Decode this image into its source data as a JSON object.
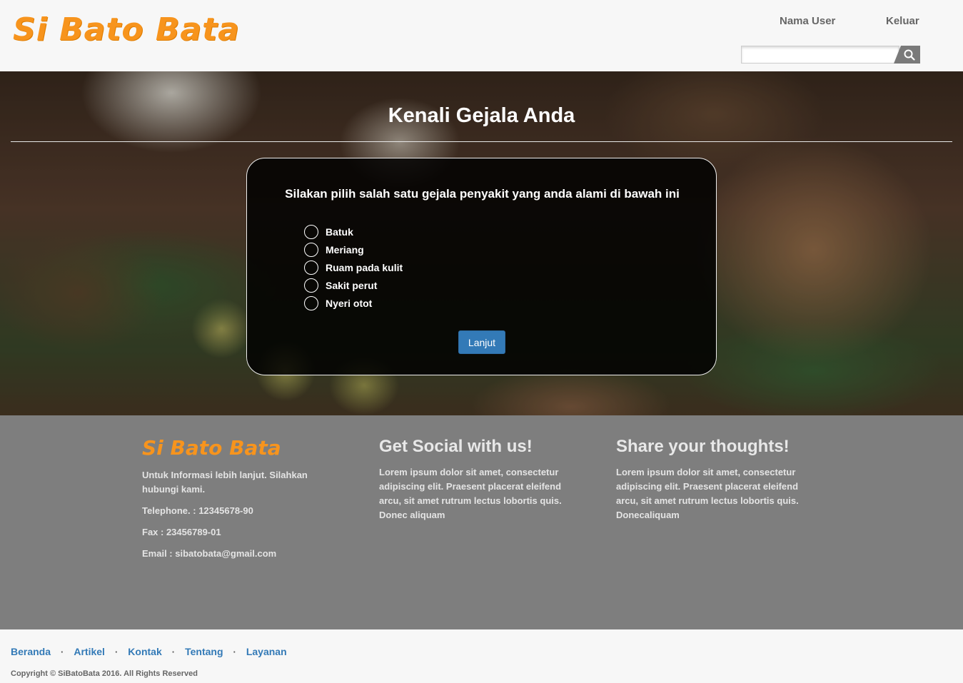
{
  "header": {
    "logo": "Si Bato Bata",
    "user_label": "Nama User",
    "logout_label": "Keluar",
    "search": {
      "value": "",
      "placeholder": "",
      "icon": "search-icon"
    }
  },
  "hero": {
    "title": "Kenali Gejala Anda",
    "question": "Silakan pilih salah satu gejala penyakit yang anda alami di bawah ini",
    "options": [
      {
        "label": "Batuk",
        "selected": false
      },
      {
        "label": "Meriang",
        "selected": false
      },
      {
        "label": "Ruam pada kulit",
        "selected": false
      },
      {
        "label": "Sakit perut",
        "selected": false
      },
      {
        "label": "Nyeri otot",
        "selected": false
      }
    ],
    "next_label": "Lanjut"
  },
  "footer": {
    "col1": {
      "logo": "Si Bato Bata",
      "info": "Untuk Informasi lebih lanjut. Silahkan hubungi kami.",
      "phone": "Telephone. : 12345678-90",
      "fax": "Fax : 23456789-01",
      "email": "Email : sibatobata@gmail.com"
    },
    "col2": {
      "title": "Get Social with us!",
      "text": "Lorem ipsum dolor sit amet, consectetur adipiscing elit. Praesent placerat eleifend arcu, sit amet rutrum lectus lobortis quis. Donec aliquam"
    },
    "col3": {
      "title": "Share your thoughts!",
      "text": "Lorem ipsum dolor sit amet, consectetur adipiscing elit. Praesent placerat eleifend arcu, sit amet rutrum lectus lobortis quis. Donecaliquam"
    }
  },
  "bottom": {
    "links": [
      "Beranda",
      "Artikel",
      "Kontak",
      "Tentang",
      "Layanan"
    ],
    "separator": "·",
    "copyright": "Copyright © SiBatoBata 2016. All Rights Reserved"
  },
  "colors": {
    "brand_orange": "#f7941d",
    "link_blue": "#337ab7",
    "footer_gray": "#7e7e7e",
    "page_bg": "#f7f7f7"
  }
}
